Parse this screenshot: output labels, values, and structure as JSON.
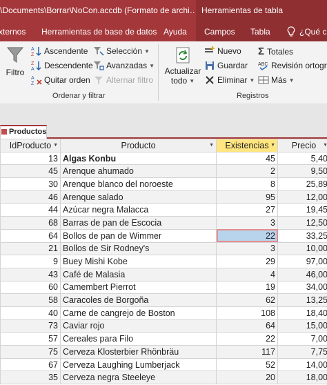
{
  "window": {
    "title": "\\Documents\\Borrar\\NoCon.accdb (Formato de archi…",
    "context_title": "Herramientas de tabla"
  },
  "tabs": [
    {
      "label": "xternos"
    },
    {
      "label": "Herramientas de base de datos"
    },
    {
      "label": "Ayuda"
    },
    {
      "label": "Campos"
    },
    {
      "label": "Tabla"
    },
    {
      "label": "¿Qué c"
    }
  ],
  "ribbon": {
    "sort_filter": {
      "filter_label": "Filtro",
      "ascending_label": "Ascendente",
      "descending_label": "Descendente",
      "remove_sort_label": "Quitar orden",
      "selection_label": "Selección",
      "advanced_label": "Avanzadas",
      "toggle_filter_label": "Alternar filtro",
      "group_label": "Ordenar y filtrar"
    },
    "records": {
      "refresh_label_1": "Actualizar",
      "refresh_label_2": "todo",
      "new_label": "Nuevo",
      "save_label": "Guardar",
      "delete_label": "Eliminar",
      "totals_label": "Totales",
      "spelling_label": "Revisión ortográ",
      "more_label": "Más",
      "group_label": "Registros"
    }
  },
  "document_tab": {
    "label": "Productos"
  },
  "datasheet": {
    "columns": [
      "IdProducto",
      "Producto",
      "Existencias",
      "Precio"
    ],
    "rows": [
      {
        "id": "13",
        "name": "Algas Konbu",
        "stock": "45",
        "price": "5,40"
      },
      {
        "id": "45",
        "name": "Arenque ahumado",
        "stock": "2",
        "price": "9,50"
      },
      {
        "id": "30",
        "name": "Arenque blanco del noroeste",
        "stock": "8",
        "price": "25,89"
      },
      {
        "id": "46",
        "name": "Arenque salado",
        "stock": "95",
        "price": "12,00"
      },
      {
        "id": "44",
        "name": "Azúcar negra Malacca",
        "stock": "27",
        "price": "19,45"
      },
      {
        "id": "68",
        "name": "Barras de pan de Escocia",
        "stock": "3",
        "price": "12,50"
      },
      {
        "id": "64",
        "name": "Bollos de pan de Wimmer",
        "stock": "22",
        "price": "33,25"
      },
      {
        "id": "21",
        "name": "Bollos de Sir Rodney's",
        "stock": "3",
        "price": "10,00"
      },
      {
        "id": "9",
        "name": "Buey Mishi Kobe",
        "stock": "29",
        "price": "97,00"
      },
      {
        "id": "43",
        "name": "Café de Malasia",
        "stock": "4",
        "price": "46,00"
      },
      {
        "id": "60",
        "name": "Camembert Pierrot",
        "stock": "19",
        "price": "34,00"
      },
      {
        "id": "58",
        "name": "Caracoles de Borgoña",
        "stock": "62",
        "price": "13,25"
      },
      {
        "id": "40",
        "name": "Carne de cangrejo de Boston",
        "stock": "108",
        "price": "18,40"
      },
      {
        "id": "73",
        "name": "Caviar rojo",
        "stock": "64",
        "price": "15,00"
      },
      {
        "id": "57",
        "name": "Cereales para Filo",
        "stock": "22",
        "price": "7,00"
      },
      {
        "id": "75",
        "name": "Cerveza Klosterbier Rhönbräu",
        "stock": "117",
        "price": "7,75"
      },
      {
        "id": "67",
        "name": "Cerveza Laughing Lumberjack",
        "stock": "52",
        "price": "14,00"
      },
      {
        "id": "35",
        "name": "Cerveza negra Steeleye",
        "stock": "20",
        "price": "18,00"
      }
    ]
  },
  "colors": {
    "accent": "#a4373a",
    "context_tab": "#8f2f32",
    "sorted_header": "#ffe680",
    "selected_cell": "#b8d3ec"
  }
}
